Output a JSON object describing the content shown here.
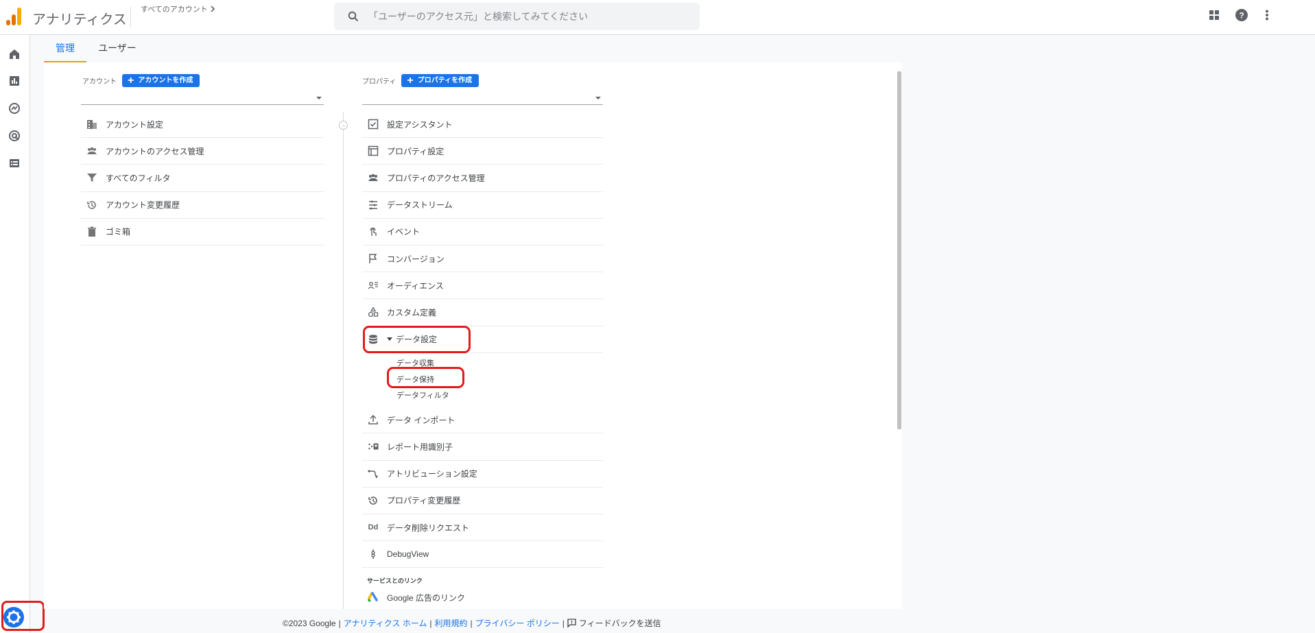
{
  "app": {
    "title": "アナリティクス",
    "account_crumb": "すべてのアカウント"
  },
  "search": {
    "placeholder": "「ユーザーのアクセス元」と検索してみてください"
  },
  "tabs": [
    {
      "label": "管理"
    },
    {
      "label": "ユーザー"
    }
  ],
  "account_col": {
    "label": "アカウント",
    "create_label": "アカウントを作成",
    "items": [
      {
        "label": "アカウント設定",
        "icon": "building-icon"
      },
      {
        "label": "アカウントのアクセス管理",
        "icon": "people-icon"
      },
      {
        "label": "すべてのフィルタ",
        "icon": "filter-icon"
      },
      {
        "label": "アカウント変更履歴",
        "icon": "history-icon"
      },
      {
        "label": "ゴミ箱",
        "icon": "trash-icon"
      }
    ]
  },
  "property_col": {
    "label": "プロパティ",
    "create_label": "プロパティを作成",
    "items": [
      {
        "label": "設定アシスタント",
        "icon": "checkbox-icon"
      },
      {
        "label": "プロパティ設定",
        "icon": "layout-icon"
      },
      {
        "label": "プロパティのアクセス管理",
        "icon": "people-icon"
      },
      {
        "label": "データストリーム",
        "icon": "streams-icon"
      },
      {
        "label": "イベント",
        "icon": "touch-icon"
      },
      {
        "label": "コンバージョン",
        "icon": "flag-icon"
      },
      {
        "label": "オーディエンス",
        "icon": "audience-icon"
      },
      {
        "label": "カスタム定義",
        "icon": "shapes-icon"
      },
      {
        "label": "データ設定",
        "icon": "database-icon"
      }
    ],
    "data_settings_sub": [
      {
        "label": "データ収集"
      },
      {
        "label": "データ保持"
      },
      {
        "label": "データフィルタ"
      }
    ],
    "items_after": [
      {
        "label": "データ インポート",
        "icon": "upload-icon"
      },
      {
        "label": "レポート用識別子",
        "icon": "identity-icon"
      },
      {
        "label": "アトリビューション設定",
        "icon": "attribution-icon"
      },
      {
        "label": "プロパティ変更履歴",
        "icon": "history-icon"
      },
      {
        "label": "データ削除リクエスト",
        "icon": "dd-icon"
      },
      {
        "label": "DebugView",
        "icon": "debug-icon"
      }
    ],
    "links_section": "サービスとのリンク",
    "links": [
      {
        "label": "Google 広告のリンク",
        "icon": "google-ads-icon"
      }
    ],
    "dd_glyph": "Dd"
  },
  "footer": {
    "copyright": "©2023 Google",
    "home": "アナリティクス ホーム",
    "terms": "利用規約",
    "privacy": "プライバシー ポリシー",
    "feedback": "フィードバックを送信",
    "separator": "|"
  },
  "colors": {
    "accent": "#1a73e8",
    "tab_underline": "#f29900",
    "highlight": "#e11b1b"
  }
}
